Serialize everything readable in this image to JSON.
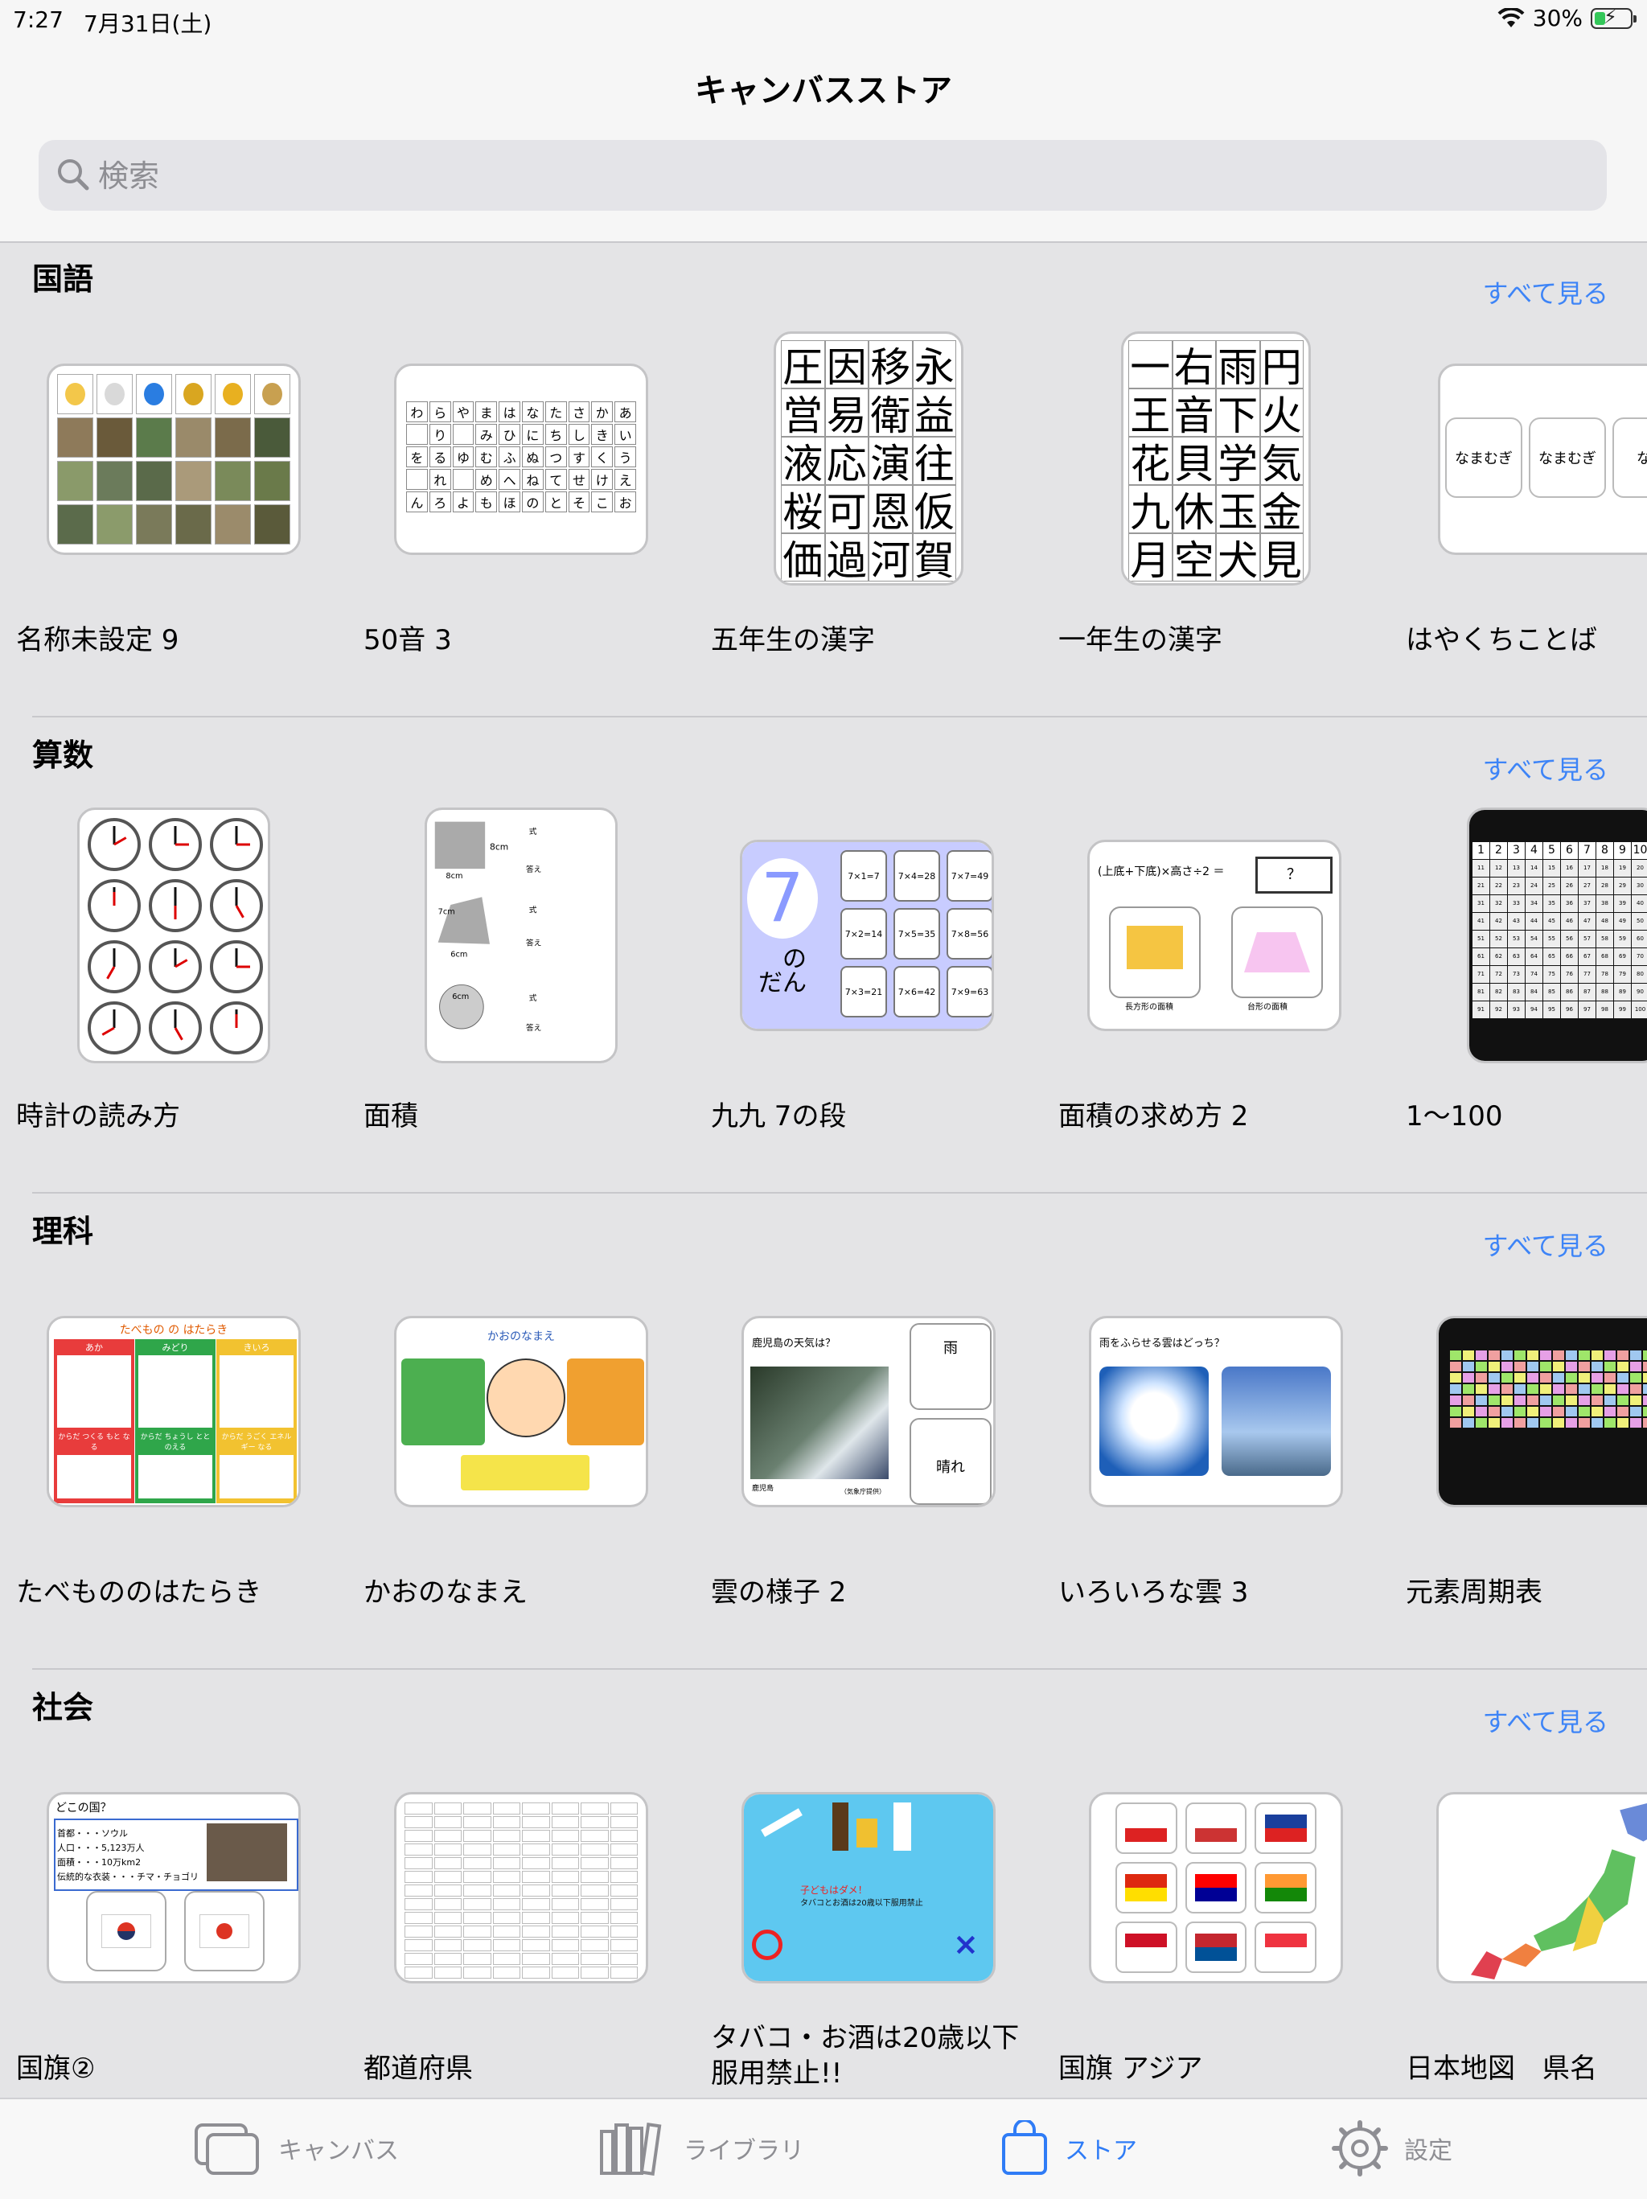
{
  "status": {
    "time": "7:27",
    "date": "7月31日(土)",
    "battery": "30%",
    "battery_level": 0.3
  },
  "nav": {
    "title": "キャンバスストア"
  },
  "search": {
    "placeholder": "検索"
  },
  "sections": [
    {
      "title": "国語",
      "see_all": "すべて見る",
      "cards": [
        {
          "title": "名称未設定 9"
        },
        {
          "title": "50音 3"
        },
        {
          "title": "五年生の漢字"
        },
        {
          "title": "一年生の漢字"
        },
        {
          "title": "はやくちことば"
        }
      ]
    },
    {
      "title": "算数",
      "see_all": "すべて見る",
      "cards": [
        {
          "title": "時計の読み方"
        },
        {
          "title": "面積"
        },
        {
          "title": "九九 7の段"
        },
        {
          "title": "面積の求め方 2"
        },
        {
          "title": "1〜100"
        }
      ]
    },
    {
      "title": "理科",
      "see_all": "すべて見る",
      "cards": [
        {
          "title": "たべもののはたらき"
        },
        {
          "title": "かおのなまえ"
        },
        {
          "title": "雲の様子 2"
        },
        {
          "title": "いろいろな雲 3"
        },
        {
          "title": "元素周期表"
        }
      ]
    },
    {
      "title": "社会",
      "see_all": "すべて見る",
      "cards": [
        {
          "title": "国旗②"
        },
        {
          "title": "都道府県"
        },
        {
          "title": "タバコ・お酒は20歳以下服用禁止!!"
        },
        {
          "title": "国旗 アジア"
        },
        {
          "title": "日本地図　県名"
        }
      ]
    }
  ],
  "thumbs": {
    "kana50": [
      "わ",
      "ら",
      "や",
      "ま",
      "は",
      "な",
      "た",
      "さ",
      "か",
      "あ",
      "",
      "り",
      "",
      "み",
      "ひ",
      "に",
      "ち",
      "し",
      "き",
      "い",
      "を",
      "る",
      "ゆ",
      "む",
      "ふ",
      "ぬ",
      "つ",
      "す",
      "く",
      "う",
      "",
      "れ",
      "",
      "め",
      "へ",
      "ね",
      "て",
      "せ",
      "け",
      "え",
      "ん",
      "ろ",
      "よ",
      "も",
      "ほ",
      "の",
      "と",
      "そ",
      "こ",
      "お"
    ],
    "kanji5": [
      "圧",
      "因",
      "移",
      "永",
      "営",
      "易",
      "衛",
      "益",
      "液",
      "応",
      "演",
      "往",
      "桜",
      "可",
      "恩",
      "仮",
      "価",
      "過",
      "河",
      "賀"
    ],
    "kanji1": [
      "一",
      "右",
      "雨",
      "円",
      "王",
      "音",
      "下",
      "火",
      "花",
      "貝",
      "学",
      "気",
      "九",
      "休",
      "玉",
      "金",
      "月",
      "空",
      "犬",
      "見"
    ],
    "hayakuchi": [
      "なまむぎ",
      "なまむぎ",
      "なま"
    ],
    "menseki": {
      "square": "8cm",
      "tri_a": "7cm",
      "tri_b": "6cm",
      "circle": "6cm",
      "shiki": "式",
      "kotae": "答え"
    },
    "kuku7": {
      "seven": "7",
      "no": "の",
      "dan": "だん",
      "items": [
        "7×1=7",
        "7×4=28",
        "7×7=49",
        "7×2=14",
        "7×5=35",
        "7×8=56",
        "7×3=21",
        "7×6=42",
        "7×9=63"
      ]
    },
    "menseki2": {
      "formula": "(上底+下底)×高さ÷2 ＝",
      "answer": "？",
      "rect": "長方形の面積",
      "trap": "台形の面積"
    },
    "tabemono": {
      "title": "たべもの の はたらき",
      "cols": [
        "あか",
        "みどり",
        "きいろ"
      ],
      "roles": [
        "からだ つくる もと なる",
        "からだ ちょうし ととのえる",
        "からだ うごく エネルギー なる"
      ]
    },
    "kao": {
      "title": "かおのなまえ"
    },
    "kumo2": {
      "q": "鹿児島の天気は？",
      "a1": "雨",
      "a2": "晴れ",
      "place": "鹿児島",
      "credit": "（気象庁提供）"
    },
    "kumo3": {
      "q": "雨をふらせる雲はどっち？"
    },
    "kokki": {
      "q": "どこの国？",
      "lines": [
        "首都・・・ソウル",
        "人口・・・5,123万人",
        "面積・・・10万km2",
        "伝統的な衣装・・・チマ・チョゴリ"
      ]
    },
    "tabako": {
      "line1": "子どもはダメ！",
      "line2": "タバコとお酒は20歳以下服用禁止"
    }
  },
  "tabs": [
    {
      "label": "キャンバス",
      "icon": "canvas-icon"
    },
    {
      "label": "ライブラリ",
      "icon": "library-icon"
    },
    {
      "label": "ストア",
      "icon": "store-bag-icon"
    },
    {
      "label": "設定",
      "icon": "settings-gear-icon"
    }
  ],
  "colors": {
    "accent": "#2f7cf6",
    "see_all": "#3d84f7",
    "background": "#e4e4e6",
    "battery": "#34c759"
  }
}
